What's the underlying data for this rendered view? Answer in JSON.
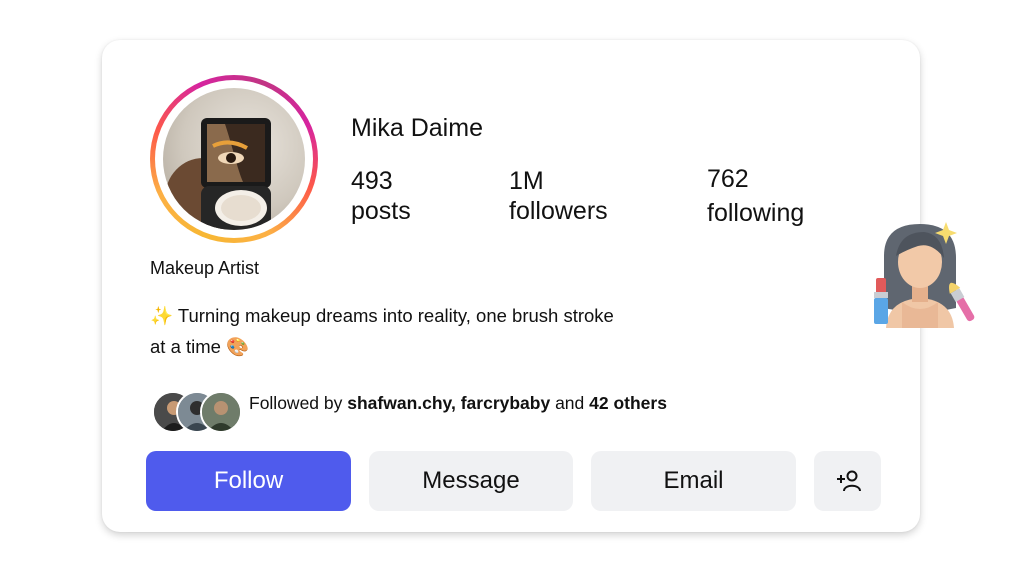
{
  "profile": {
    "username": "Mika Daime",
    "category": "Makeup Artist",
    "bio_line1": "✨ Turning makeup dreams into reality, one brush stroke",
    "bio_line2": "at a time 🎨"
  },
  "stats": {
    "posts_count": "493",
    "posts_label": "posts",
    "followers_count": "1M",
    "followers_label": "followers",
    "following_count": "762",
    "following_label": "following"
  },
  "followed_by": {
    "prefix": "Followed by ",
    "names": "shafwan.chy, farcrybaby",
    "middle": " and ",
    "others": "42 others"
  },
  "actions": {
    "follow_label": "Follow",
    "message_label": "Message",
    "email_label": "Email",
    "add_user_icon": "add-user-icon"
  },
  "colors": {
    "follow_button": "#4f5bed",
    "secondary_button": "#f0f1f3",
    "story_ring": [
      "#f7b733",
      "#fd5949",
      "#d6249f"
    ]
  },
  "decoration": {
    "icon": "makeup-artist-emoji"
  }
}
